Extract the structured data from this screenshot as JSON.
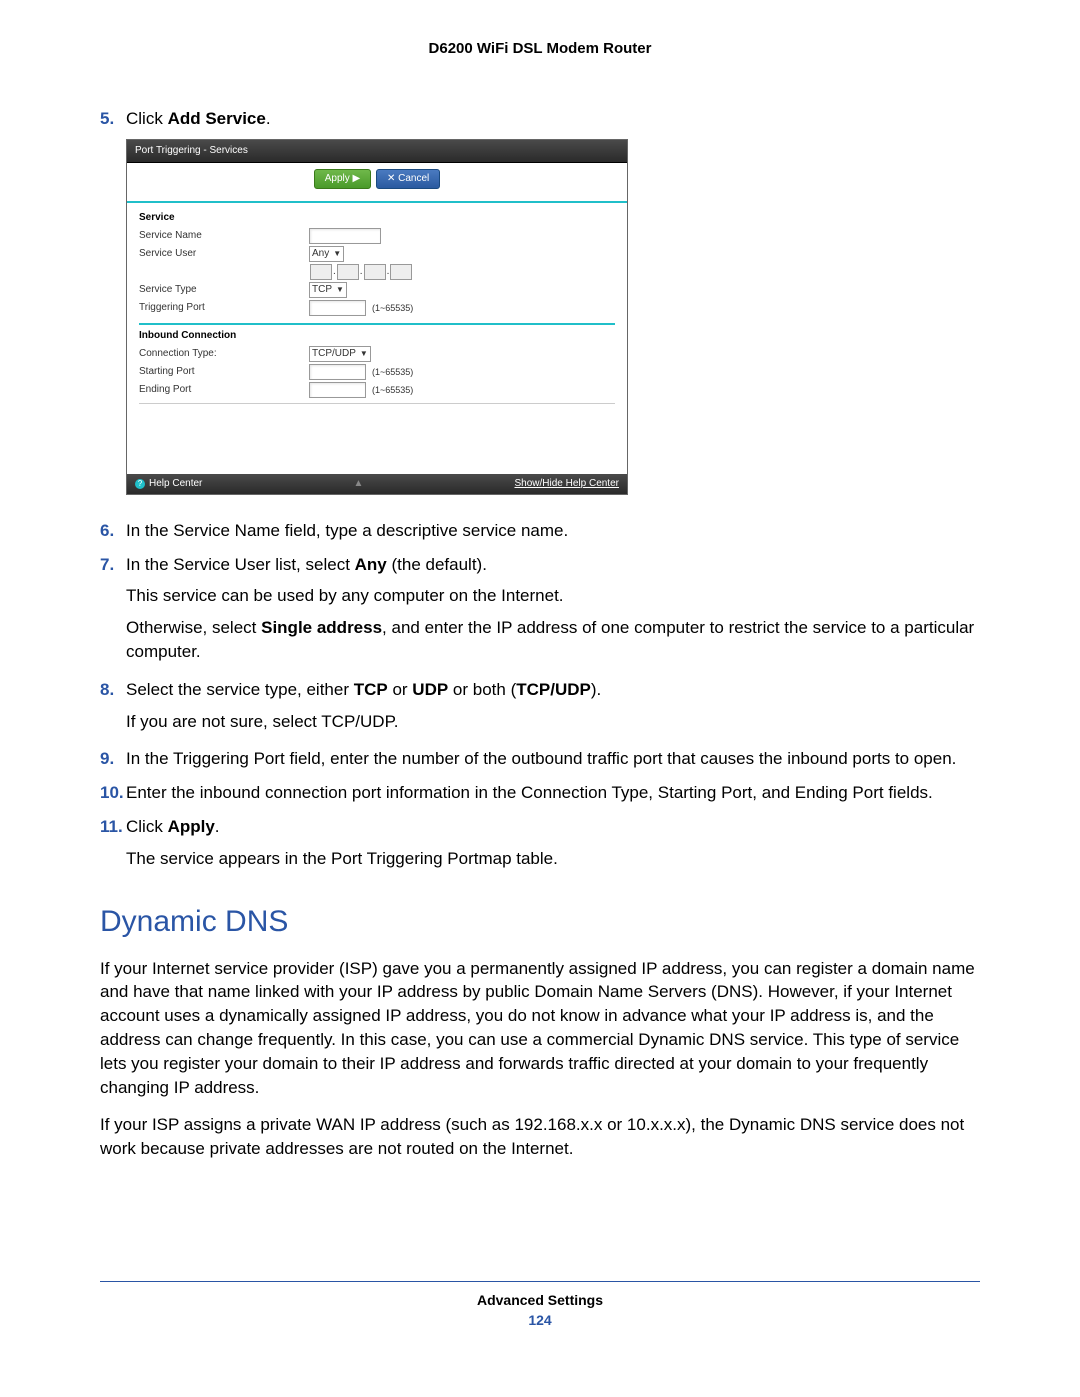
{
  "header": {
    "title": "D6200 WiFi DSL Modem Router"
  },
  "steps": {
    "s5": {
      "num": "5.",
      "prefix": "Click ",
      "bold": "Add Service",
      "suffix": "."
    },
    "s6": {
      "num": "6.",
      "text": "In the Service Name field, type a descriptive service name."
    },
    "s7": {
      "num": "7.",
      "prefix": "In the Service User list, select ",
      "bold": "Any",
      "suffix": " (the default).",
      "sub1": "This service can be used by any computer on the Internet.",
      "sub2_prefix": "Otherwise, select ",
      "sub2_bold": "Single address",
      "sub2_suffix": ", and enter the IP address of one computer to restrict the service to a particular computer."
    },
    "s8": {
      "num": "8.",
      "prefix": "Select the service type, either ",
      "b1": "TCP",
      "mid1": " or ",
      "b2": "UDP",
      "mid2": " or both (",
      "b3": "TCP/UDP",
      "suffix": ").",
      "sub": "If you are not sure, select TCP/UDP."
    },
    "s9": {
      "num": "9.",
      "text": "In the Triggering Port field, enter the number of the outbound traffic port that causes the inbound ports to open."
    },
    "s10": {
      "num": "10.",
      "text": "Enter the inbound connection port information in the Connection Type, Starting Port, and Ending Port fields."
    },
    "s11": {
      "num": "11.",
      "prefix": "Click ",
      "bold": "Apply",
      "suffix": ".",
      "sub": "The service appears in the Port Triggering Portmap table."
    }
  },
  "section": {
    "heading": "Dynamic DNS",
    "p1": "If your Internet service provider (ISP) gave you a permanently assigned IP address, you can register a domain name and have that name linked with your IP address by public Domain Name Servers (DNS). However, if your Internet account uses a dynamically assigned IP address, you do not know in advance what your IP address is, and the address can change frequently. In this case, you can use a commercial Dynamic DNS service. This type of service lets you register your domain to their IP address and forwards traffic directed at your domain to your frequently changing IP address.",
    "p2": "If your ISP assigns a private WAN IP address (such as 192.168.x.x or 10.x.x.x), the Dynamic DNS service does not work because private addresses are not routed on the Internet."
  },
  "footer": {
    "label": "Advanced Settings",
    "page": "124"
  },
  "screenshot": {
    "title": "Port Triggering - Services",
    "apply": "Apply ▶",
    "cancel": "✕ Cancel",
    "service_head": "Service",
    "rows": {
      "service_name": "Service Name",
      "service_user": "Service User",
      "service_user_value": "Any",
      "service_type": "Service Type",
      "service_type_value": "TCP",
      "triggering_port": "Triggering Port",
      "range_hint": "(1~65535)"
    },
    "inbound_head": "Inbound Connection",
    "inbound": {
      "conn_type": "Connection Type:",
      "conn_type_value": "TCP/UDP",
      "start_port": "Starting Port",
      "end_port": "Ending Port"
    },
    "help": "Help Center",
    "showhide": "Show/Hide Help Center"
  }
}
